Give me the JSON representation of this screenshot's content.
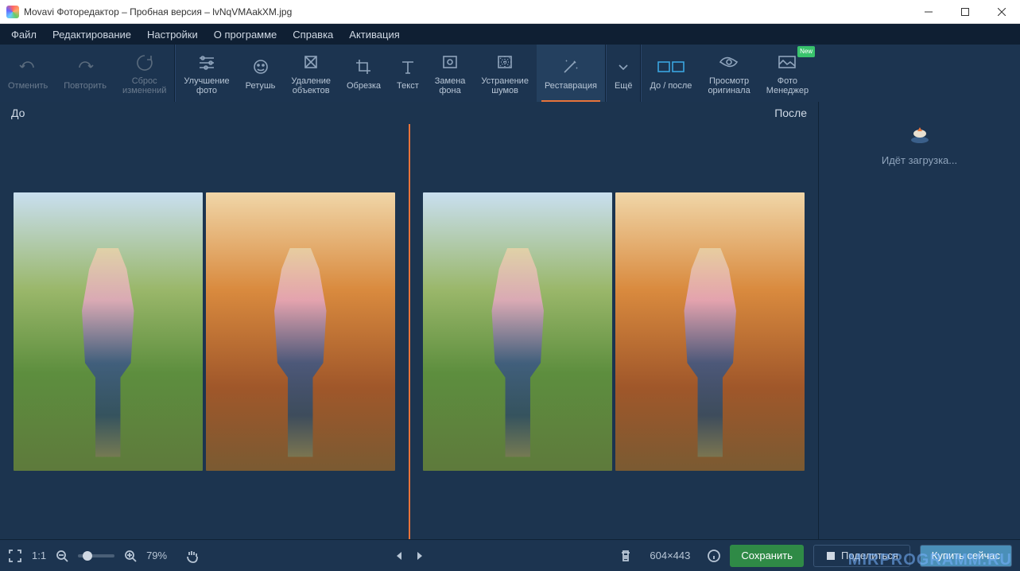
{
  "titlebar": {
    "title": "Movavi Фоторедактор – Пробная версия – lvNqVMAakXM.jpg"
  },
  "menu": {
    "file": "Файл",
    "edit": "Редактирование",
    "settings": "Настройки",
    "about": "О программе",
    "help": "Справка",
    "activation": "Активация"
  },
  "toolbar": {
    "undo": "Отменить",
    "redo": "Повторить",
    "reset": "Сброс\nизменений",
    "enhance": "Улучшение\nфото",
    "retouch": "Ретушь",
    "remove": "Удаление\nобъектов",
    "crop": "Обрезка",
    "text": "Текст",
    "bg": "Замена\nфона",
    "noise": "Устранение\nшумов",
    "restore": "Реставрация",
    "more": "Ещё",
    "ba": "До / после",
    "orig": "Просмотр\nоригинала",
    "manager": "Фото\nМенеджер",
    "new_badge": "New"
  },
  "canvas": {
    "before": "До",
    "after": "После"
  },
  "sidepanel": {
    "loading": "Идёт загрузка..."
  },
  "bottombar": {
    "ratio": "1:1",
    "zoom": "79%",
    "dims": "604×443",
    "save": "Сохранить",
    "share": "Поделиться",
    "buy": "Купить сейчас"
  },
  "watermark": "MIRPROGRAMM.RU"
}
